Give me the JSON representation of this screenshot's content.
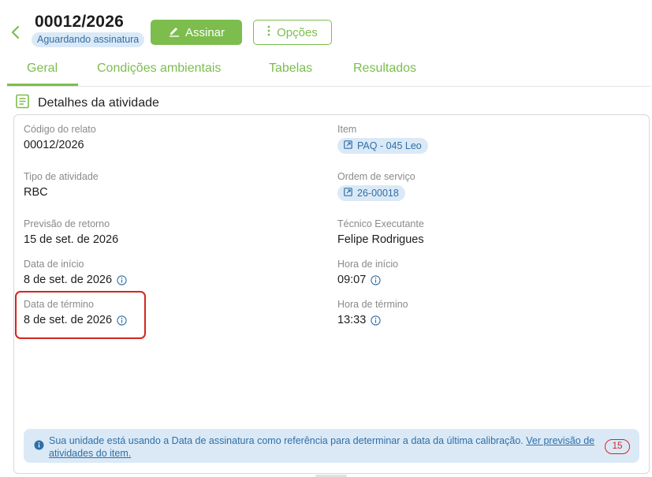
{
  "header": {
    "code": "00012/2026",
    "status": "Aguardando assinatura",
    "sign_label": "Assinar",
    "options_label": "Opções"
  },
  "tabs": [
    {
      "label": "Geral",
      "active": true
    },
    {
      "label": "Condições ambientais",
      "active": false
    },
    {
      "label": "Tabelas",
      "active": false
    },
    {
      "label": "Resultados",
      "active": false
    }
  ],
  "section": {
    "title": "Detalhes da atividade"
  },
  "details": {
    "codigo": {
      "label": "Código do relato",
      "value": "00012/2026"
    },
    "item": {
      "label": "Item",
      "value": "PAQ - 045 Leo"
    },
    "tipo": {
      "label": "Tipo de atividade",
      "value": "RBC"
    },
    "ordem": {
      "label": "Ordem de serviço",
      "value": "26-00018"
    },
    "previsao": {
      "label": "Previsão de retorno",
      "value": "15 de set. de 2026"
    },
    "tecnico": {
      "label": "Técnico Executante",
      "value": "Felipe Rodrigues"
    },
    "data_inicio": {
      "label": "Data de início",
      "value": "8 de set. de 2026"
    },
    "hora_inicio": {
      "label": "Hora de início",
      "value": "09:07"
    },
    "data_termino": {
      "label": "Data de término",
      "value": "8 de set. de 2026"
    },
    "hora_termino": {
      "label": "Hora de término",
      "value": "13:33"
    }
  },
  "notice": {
    "text": "Sua unidade está usando a Data de assinatura como referência para determinar a data da última calibração.",
    "link": "Ver previsão de atividades do item."
  },
  "badge_count": "15",
  "colors": {
    "accent": "#7cbd4e",
    "info": "#2f6fa8",
    "info_bg": "#dbe9f6",
    "alert": "#d3261f"
  }
}
